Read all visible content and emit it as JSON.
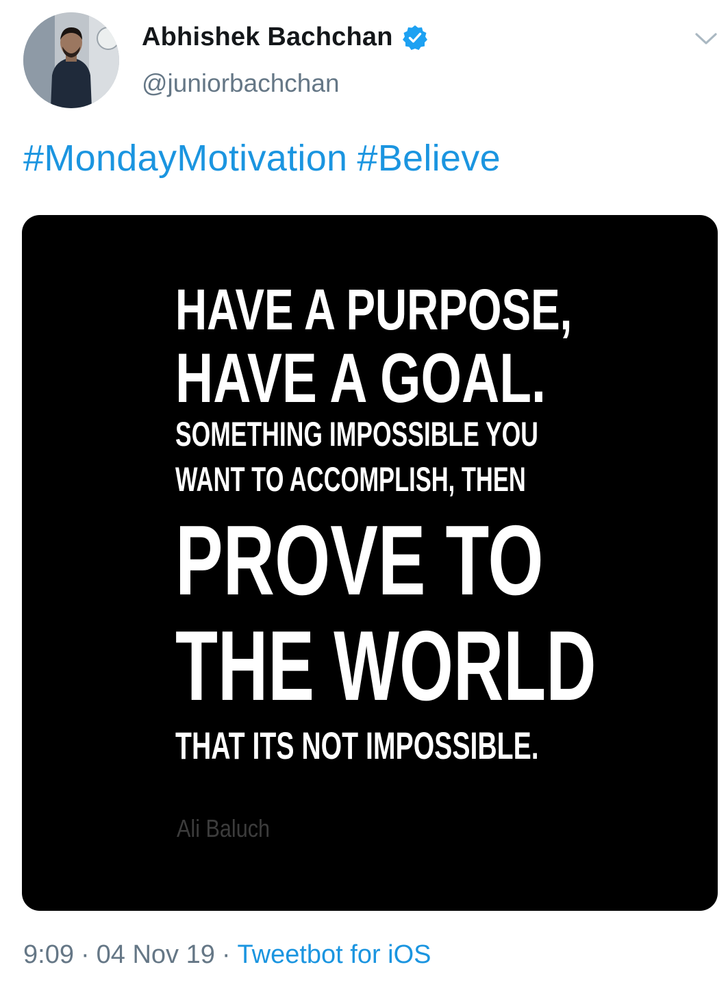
{
  "author": {
    "display_name": "Abhishek Bachchan",
    "handle": "@juniorbachchan",
    "verified": true,
    "verified_icon": "verified-badge-icon",
    "avatar": "profile-photo"
  },
  "menu_icon": "chevron-down-icon",
  "tweet": {
    "hashtags": [
      "#MondayMotivation",
      "#Believe"
    ]
  },
  "media": {
    "background": "#000000",
    "quote_lines": [
      "HAVE A PURPOSE,",
      "HAVE A GOAL.",
      "SOMETHING IMPOSSIBLE YOU",
      "WANT TO ACCOMPLISH, THEN",
      "PROVE TO",
      "THE WORLD",
      "THAT ITS NOT IMPOSSIBLE."
    ],
    "attribution": "Ali Baluch"
  },
  "meta": {
    "time": "9:09",
    "separator": "·",
    "date": "04 Nov 19",
    "source": "Tweetbot for iOS"
  },
  "colors": {
    "link": "#1b95e0",
    "secondary_text": "#657786",
    "primary_text": "#14171a"
  }
}
